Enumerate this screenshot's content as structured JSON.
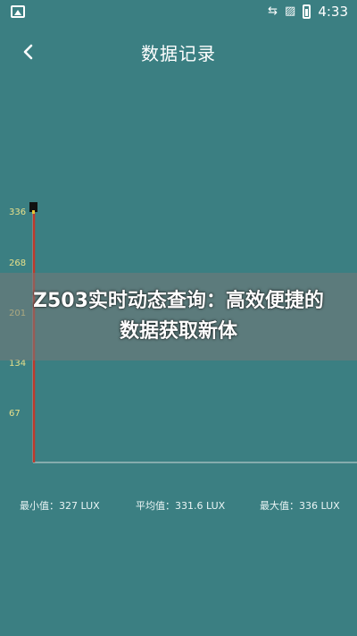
{
  "status_bar": {
    "time": "4:33",
    "icons": [
      "image-icon",
      "sync-icon",
      "no-sim-icon",
      "battery-charging-icon"
    ]
  },
  "app_bar": {
    "title": "数据记录",
    "back_icon": "chevron-left-icon"
  },
  "chart_data": {
    "type": "line",
    "y_ticks": [
      "336",
      "268",
      "201",
      "134",
      "67"
    ],
    "ylim": [
      0,
      336
    ],
    "series": [
      {
        "values": [
          0,
          336
        ],
        "color": "#c0392b"
      }
    ],
    "grid": false
  },
  "banner": {
    "text": "Z503实时动态查询：高效便捷的数据获取新体"
  },
  "stats": {
    "min": "最小值：327 LUX",
    "avg": "平均值：331.6 LUX",
    "max": "最大值：336 LUX"
  },
  "colors": {
    "background": "#3b7f82",
    "tick_label": "#e7e08a",
    "series": "#c0392b"
  }
}
